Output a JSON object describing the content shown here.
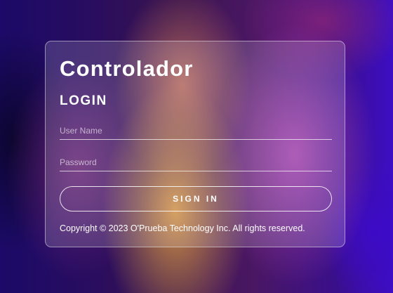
{
  "app": {
    "title": "Controlador"
  },
  "login": {
    "heading": "LOGIN",
    "username_placeholder": "User Name",
    "password_placeholder": "Password",
    "signin_label": "SIGN IN"
  },
  "footer": {
    "copyright": "Copyright © 2023 O'Prueba Technology Inc. All rights reserved."
  },
  "colors": {
    "text": "#ffffff",
    "card_border": "#ffffff"
  }
}
